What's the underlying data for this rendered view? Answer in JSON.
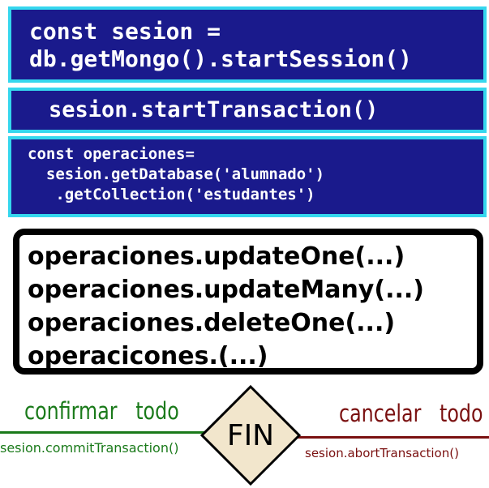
{
  "session_box": {
    "lines": [
      "const sesion =",
      "db.getMongo().startSession()"
    ]
  },
  "transaction_box": {
    "text": "sesion.startTransaction()"
  },
  "operations_setup_box": {
    "lines": [
      "const operaciones=",
      "  sesion.getDatabase('alumnado')",
      "   .getCollection('estudantes')"
    ]
  },
  "operations_list": {
    "items": [
      "operaciones.updateOne(...)",
      "operaciones.updateMany(...)",
      "operaciones.deleteOne(...)",
      "operacicones.(...)"
    ]
  },
  "end_node": {
    "label": "FIN",
    "fill_color": "#f2e6cc"
  },
  "confirm_branch": {
    "label": "confirmar   todo",
    "method": "sesion.commitTransaction()",
    "color": "#1a7a1a"
  },
  "cancel_branch": {
    "label": "cancelar   todo",
    "method": "sesion.abortTransaction()",
    "color": "#7a1010"
  }
}
